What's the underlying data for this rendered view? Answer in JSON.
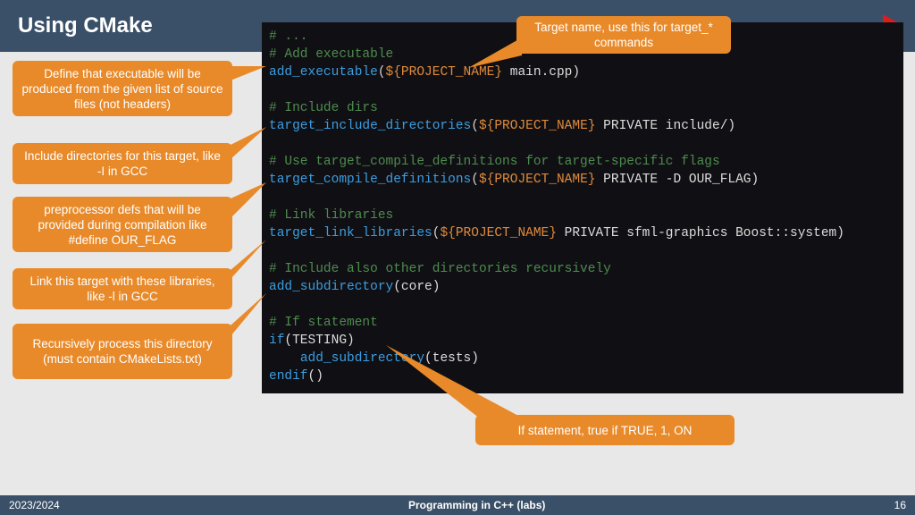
{
  "header": {
    "title": "Using CMake"
  },
  "code": {
    "c1": "# ...",
    "c2": "# Add executable",
    "fn_addexe": "add_executable",
    "proj": "${PROJECT_NAME}",
    "arg_main": " main.cpp)",
    "c3": "# Include dirs",
    "fn_incdir": "target_include_directories",
    "arg_incdir": " PRIVATE include/)",
    "c4": "# Use target_compile_definitions for target-specific flags",
    "fn_compdef": "target_compile_definitions",
    "arg_compdef": " PRIVATE -D OUR_FLAG)",
    "c5": "# Link libraries",
    "fn_linklib": "target_link_libraries",
    "arg_linklib": " PRIVATE sfml-graphics Boost::system)",
    "c6": "# Include also other directories recursively",
    "fn_addsub": "add_subdirectory",
    "arg_core": "(core)",
    "c7": "# If statement",
    "fn_if": "if",
    "arg_if": "(TESTING)",
    "indent": "    ",
    "arg_tests": "(tests)",
    "fn_endif": "endif",
    "arg_endif": "()"
  },
  "callouts": {
    "top": "Target name, use this for target_* commands",
    "c1": "Define that executable will be produced from the given list of source files (not headers)",
    "c2": "Include directories for this target, like -I in GCC",
    "c3": "preprocessor defs that will be provided during compilation like #define OUR_FLAG",
    "c4": "Link this target with these libraries, like -l in GCC",
    "c5": "Recursively process this directory (must contain CMakeLists.txt)",
    "bottom": "If statement, true if TRUE, 1, ON"
  },
  "footer": {
    "left": "2023/2024",
    "center": "Programming in C++ (labs)",
    "right": "16"
  }
}
